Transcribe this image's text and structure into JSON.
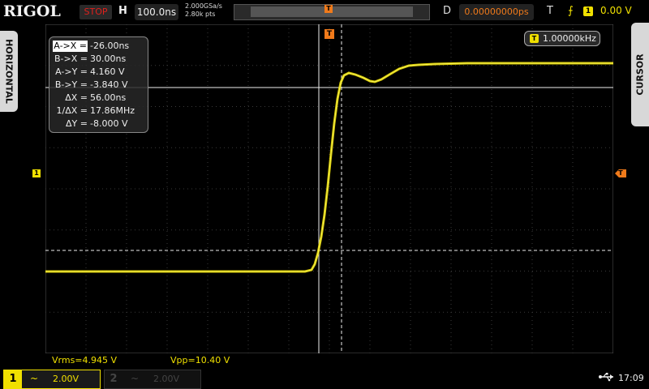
{
  "header": {
    "brand": "RIGOL",
    "run_status": "STOP",
    "h_label": "H",
    "timebase": "100.0ns",
    "sample_rate": "2.000GSa/s",
    "memory_depth": "2.80k pts",
    "trigger_pos_glyph": "T",
    "d_label": "D",
    "delay": "0.00000000ps",
    "t_label": "T",
    "trigger_edge_icon": "rising-edge-icon",
    "trigger_edge_glyph": "⨍",
    "trigger_source": "1",
    "trigger_level": "0.00 V"
  },
  "side_tabs": {
    "left": "HORIZONTAL",
    "right": "CURSOR"
  },
  "markers": {
    "ch1_offset": "1",
    "trigger_level": "T",
    "trigger_position": "T"
  },
  "cursor_readout": {
    "rows": [
      {
        "key": "A->X =",
        "value": "-26.00ns"
      },
      {
        "key": "B->X =",
        "value": "30.00ns"
      },
      {
        "key": "A->Y =",
        "value": "4.160 V"
      },
      {
        "key": "B->Y =",
        "value": "-3.840 V"
      },
      {
        "key": "ΔX =",
        "value": "56.00ns"
      },
      {
        "key": "1/ΔX =",
        "value": "17.86MHz"
      },
      {
        "key": "ΔY =",
        "value": "-8.000 V"
      }
    ]
  },
  "counter": {
    "source": "T",
    "value": "1.00000kHz"
  },
  "measurements": {
    "vrms": "Vrms=4.945 V",
    "vpp": "Vpp=10.40 V"
  },
  "channels": [
    {
      "number": "1",
      "coupling_glyph": "~",
      "scale": "2.00V",
      "active": true
    },
    {
      "number": "2",
      "coupling_glyph": "~",
      "scale": "2.00V",
      "active": false
    }
  ],
  "status": {
    "usb_icon": "usb-icon",
    "usb_glyph": "⭠",
    "time": "17:09"
  },
  "colors": {
    "ch1": "#f0e000",
    "trigger": "#f07a1a",
    "stop": "#e0201c"
  }
}
